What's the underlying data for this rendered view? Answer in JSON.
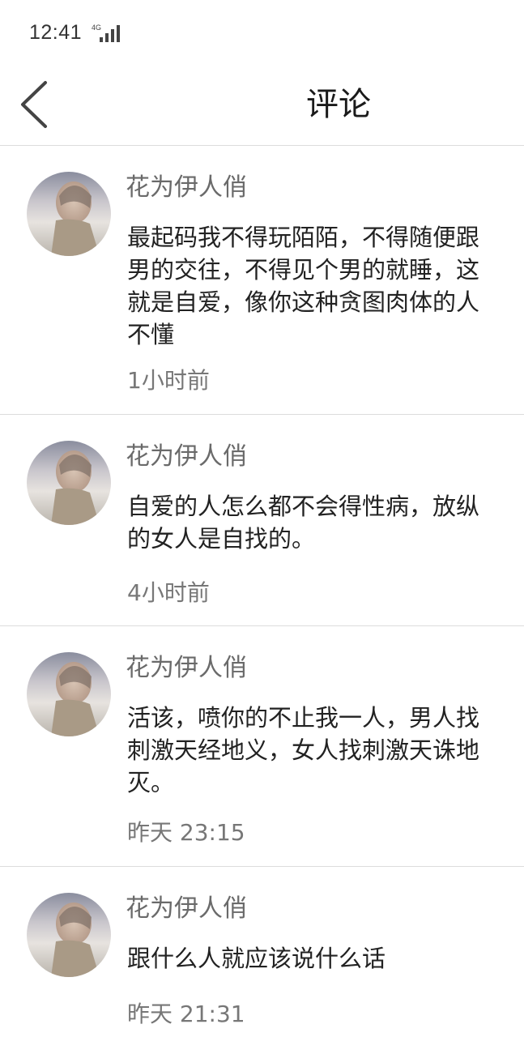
{
  "status_bar": {
    "time": "12:41",
    "network": "4G",
    "signal_icon": "signal-bars-icon"
  },
  "header": {
    "back_icon": "chevron-left-icon",
    "title": "评论"
  },
  "comments": [
    {
      "username": "花为伊人俏",
      "text": "最起码我不得玩陌陌，不得随便跟男的交往，不得见个男的就睡，这就是自爱，像你这种贪图肉体的人不懂",
      "time": "1小时前"
    },
    {
      "username": "花为伊人俏",
      "text": "自爱的人怎么都不会得性病，放纵的女人是自找的。",
      "time": "4小时前"
    },
    {
      "username": "花为伊人俏",
      "text": "活该，喷你的不止我一人，男人找刺激天经地义，女人找刺激天诛地灭。",
      "time": "昨天 23:15"
    },
    {
      "username": "花为伊人俏",
      "text": "跟什么人就应该说什么话",
      "time": "昨天 21:31"
    }
  ]
}
